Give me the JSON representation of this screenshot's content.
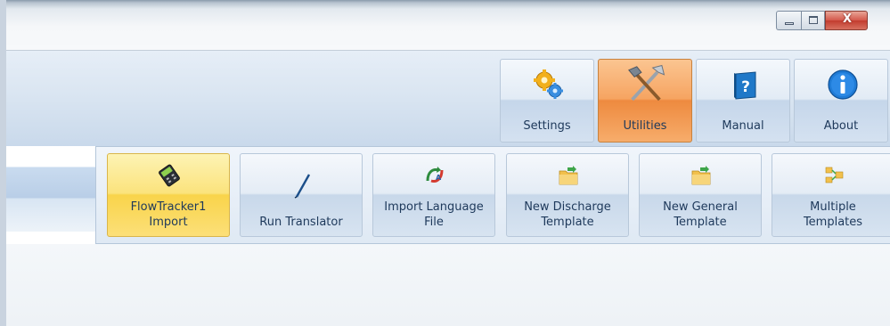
{
  "window_controls": {
    "minimize_icon": "minimize-icon",
    "maximize_icon": "maximize-icon",
    "close_label": "X"
  },
  "main_toolbar": {
    "buttons": [
      {
        "label": "Settings",
        "icon": "gear-icon",
        "active": false
      },
      {
        "label": "Utilities",
        "icon": "tools-icon",
        "active": true
      },
      {
        "label": "Manual",
        "icon": "help-book-icon",
        "active": false
      },
      {
        "label": "About",
        "icon": "info-icon",
        "active": false
      }
    ]
  },
  "utilities_menu": {
    "buttons": [
      {
        "label": "FlowTracker1\nImport",
        "icon": "device-icon",
        "active": true
      },
      {
        "label": "Run Translator",
        "icon": "pen-icon",
        "active": false
      },
      {
        "label": "Import Language\nFile",
        "icon": "language-icon",
        "active": false
      },
      {
        "label": "New Discharge\nTemplate",
        "icon": "folder-icon",
        "active": false
      },
      {
        "label": "New General\nTemplate",
        "icon": "folder-icon",
        "active": false
      },
      {
        "label": "Multiple\nTemplates",
        "icon": "multiple-templates-icon",
        "active": false
      }
    ]
  }
}
